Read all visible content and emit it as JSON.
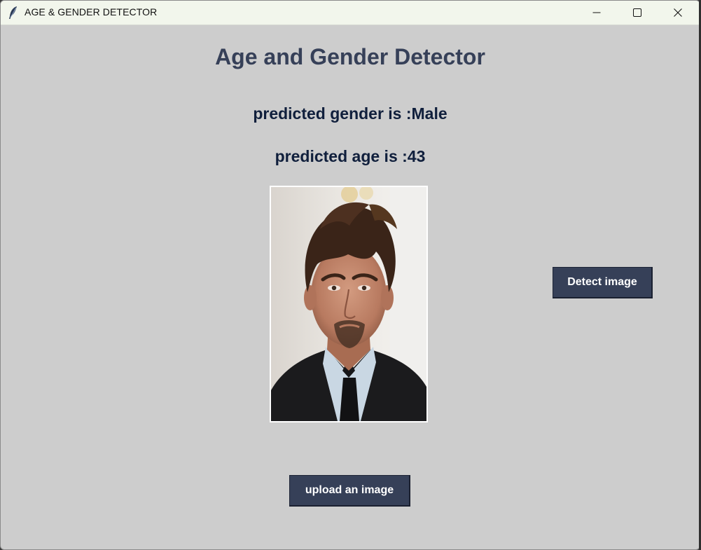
{
  "window": {
    "title": "AGE & GENDER DETECTOR"
  },
  "main": {
    "heading": "Age and Gender Detector",
    "predicted_gender": "predicted gender is :Male",
    "predicted_age": "predicted age is :43",
    "detect_button_label": "Detect image",
    "upload_button_label": "upload an image"
  },
  "icons": {
    "app": "feather-icon",
    "minimize": "minimize-icon",
    "maximize": "maximize-icon",
    "close": "close-icon"
  },
  "colors": {
    "background": "#cdcdcd",
    "heading": "#364058",
    "prediction_text": "#101f3c",
    "button_bg": "#364058",
    "button_text": "#ffffff",
    "titlebar": "#f2f6ec"
  }
}
